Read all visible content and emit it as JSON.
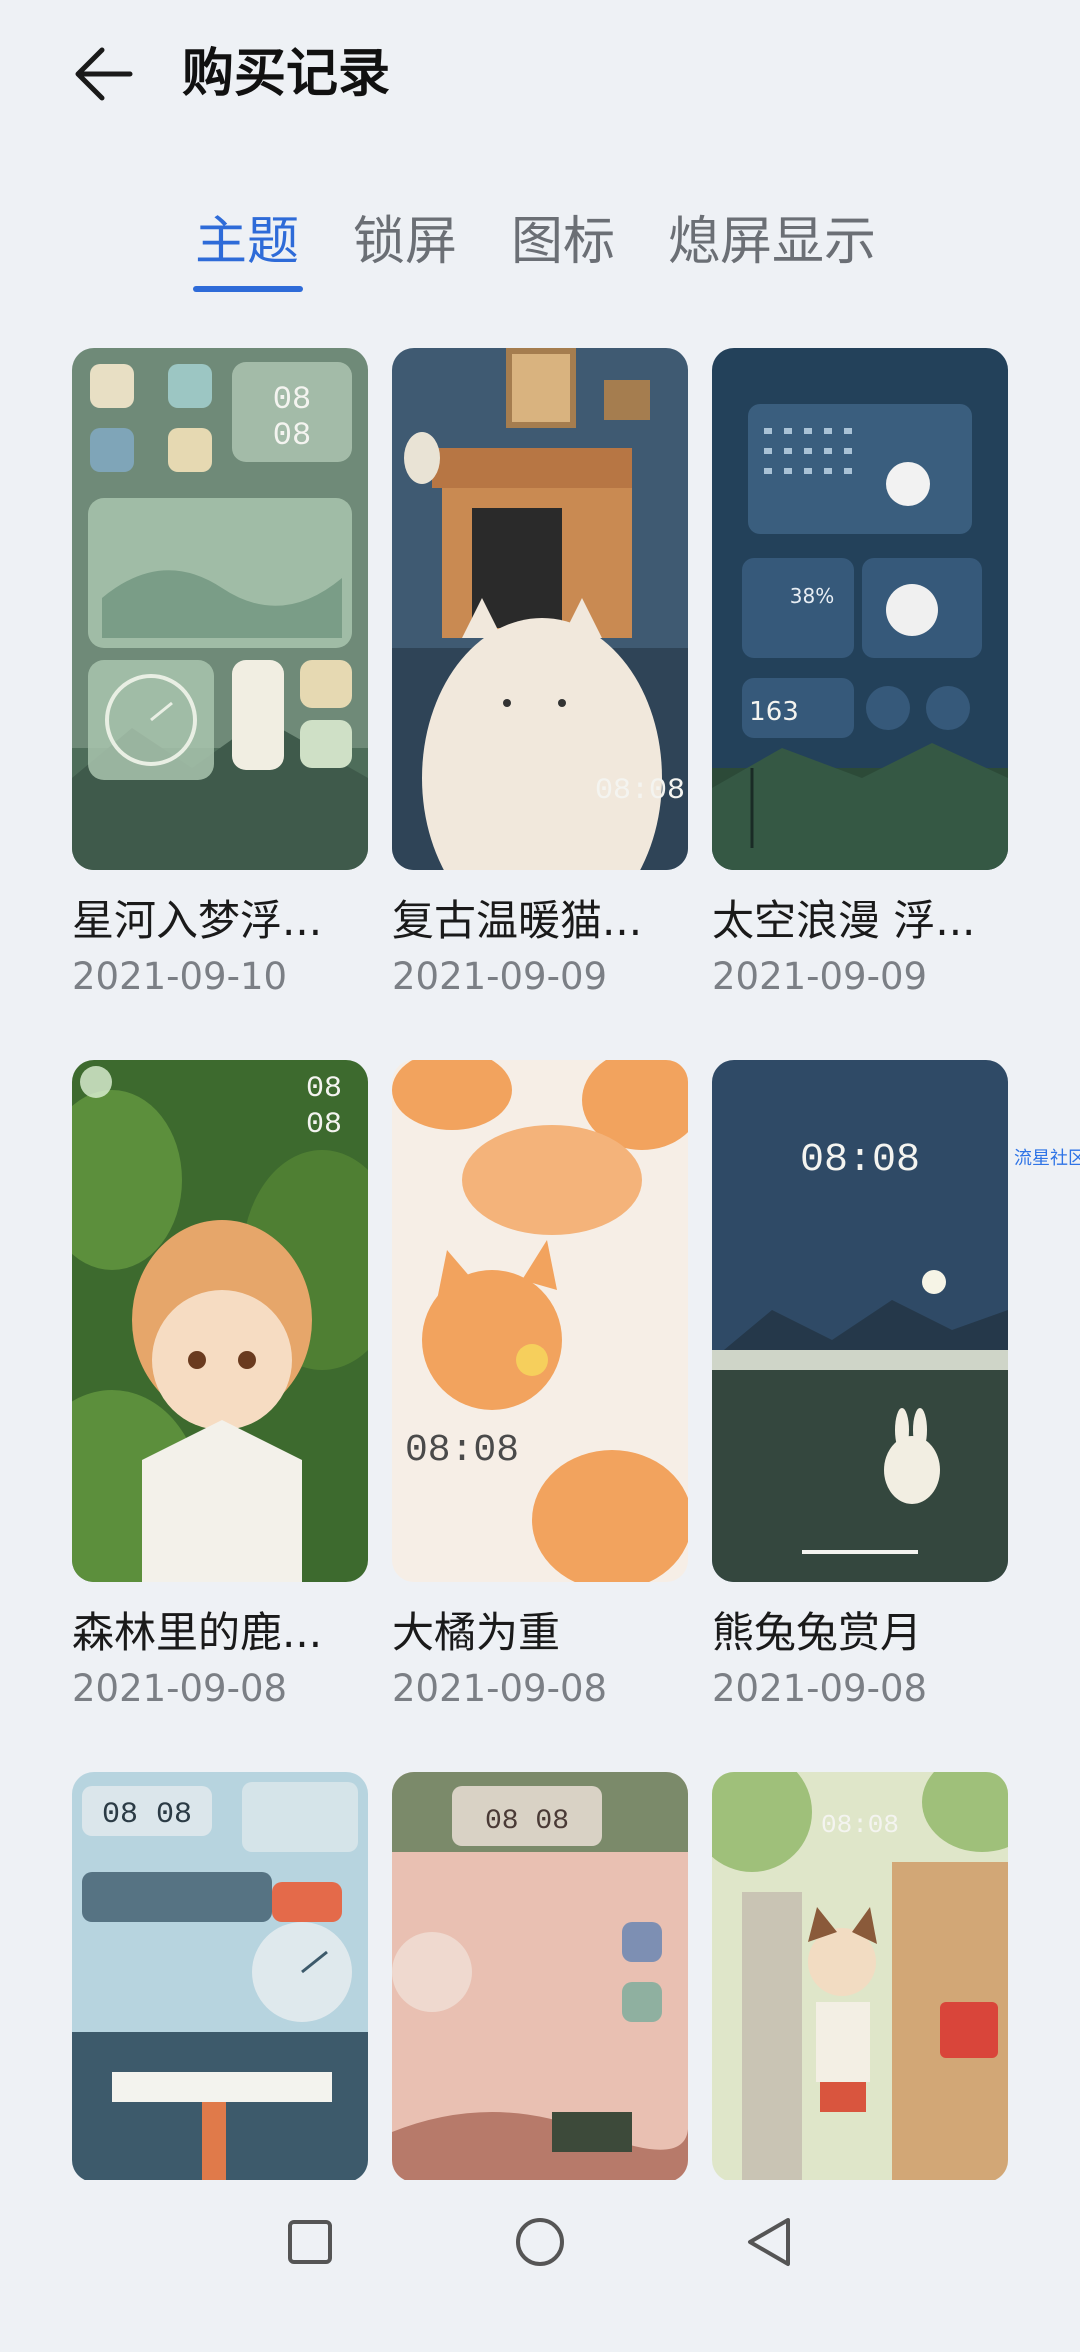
{
  "header": {
    "title": "购买记录"
  },
  "tabs": [
    {
      "label": "主题",
      "active": true
    },
    {
      "label": "锁屏",
      "active": false
    },
    {
      "label": "图标",
      "active": false
    },
    {
      "label": "熄屏显示",
      "active": false
    }
  ],
  "items": [
    {
      "title": "星河入梦浮...",
      "date": "2021-09-10",
      "clock": "08 08"
    },
    {
      "title": "复古温暖猫...",
      "date": "2021-09-09",
      "clock": "08:08"
    },
    {
      "title": "太空浪漫 浮...",
      "date": "2021-09-09",
      "clock": "163"
    },
    {
      "title": "森林里的鹿...",
      "date": "2021-09-08",
      "clock": "08 08"
    },
    {
      "title": "大橘为重",
      "date": "2021-09-08",
      "clock": "08:08"
    },
    {
      "title": "熊兔兔赏月",
      "date": "2021-09-08",
      "clock": "08:08"
    },
    {
      "title": "",
      "date": "",
      "clock": "08 08"
    },
    {
      "title": "",
      "date": "",
      "clock": "08 08"
    },
    {
      "title": "",
      "date": "",
      "clock": "08:08"
    }
  ],
  "watermark": "流星社区",
  "colors": {
    "accent": "#2e6bd8",
    "background": "#eef1f5"
  },
  "nav": {
    "recents_icon": "square-icon",
    "home_icon": "circle-icon",
    "back_icon": "triangle-back-icon"
  }
}
